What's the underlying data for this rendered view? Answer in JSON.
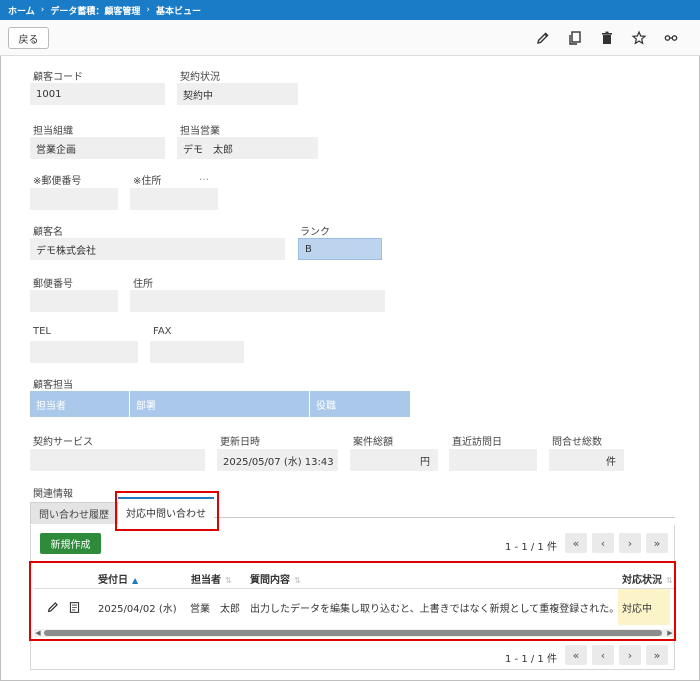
{
  "breadcrumb": {
    "home": "ホーム",
    "sep": "›",
    "db": "データ蓄積：顧客管理",
    "view": "基本ビュー"
  },
  "toolbar": {
    "back_label": "戻る"
  },
  "fields": {
    "customer_code": {
      "label": "顧客コード",
      "value": "1001"
    },
    "contract_status": {
      "label": "契約状況",
      "value": "契約中"
    },
    "org": {
      "label": "担当組織",
      "value": "営業企画"
    },
    "sales": {
      "label": "担当営業",
      "value": "デモ　太郎"
    },
    "postal_note": {
      "label": "※郵便番号",
      "value": ""
    },
    "address_note": {
      "label": "※住所",
      "value": ""
    },
    "address_note_more": "…",
    "customer_name": {
      "label": "顧客名",
      "value": "デモ株式会社"
    },
    "rank": {
      "label": "ランク",
      "value": "B"
    },
    "postal": {
      "label": "郵便番号",
      "value": ""
    },
    "address": {
      "label": "住所",
      "value": ""
    },
    "tel": {
      "label": "TEL",
      "value": ""
    },
    "fax": {
      "label": "FAX",
      "value": ""
    },
    "contact": {
      "label": "顧客担当",
      "cols": [
        "担当者",
        "部署",
        "役職"
      ]
    },
    "service": {
      "label": "契約サービス",
      "value": ""
    },
    "updated": {
      "label": "更新日時",
      "value": "2025/05/07 (水) 13:43"
    },
    "deal_total": {
      "label": "案件総額",
      "value": "円"
    },
    "last_visit": {
      "label": "直近訪問日",
      "value": ""
    },
    "inquiry_count": {
      "label": "問合せ総数",
      "value": "件"
    }
  },
  "related": {
    "label": "関連情報",
    "tabs": [
      {
        "label": "問い合わせ履歴"
      },
      {
        "label": "対応中問い合わせ"
      }
    ],
    "new_button": "新規作成",
    "pager_text": "1 - 1 / 1 件",
    "columns": [
      "受付日",
      "担当者",
      "質問内容",
      "対応状況"
    ],
    "rows": [
      {
        "date": "2025/04/02 (水)",
        "person": "営業　太郎",
        "question": "出力したデータを編集し取り込むと、上書きではなく新規として重複登録された。",
        "status": "対応中"
      }
    ]
  },
  "colors": {
    "brand": "#1a7cc7",
    "new_button": "#2e8b3a",
    "highlight": "#e00000",
    "status_bg": "#fdf3c8"
  }
}
